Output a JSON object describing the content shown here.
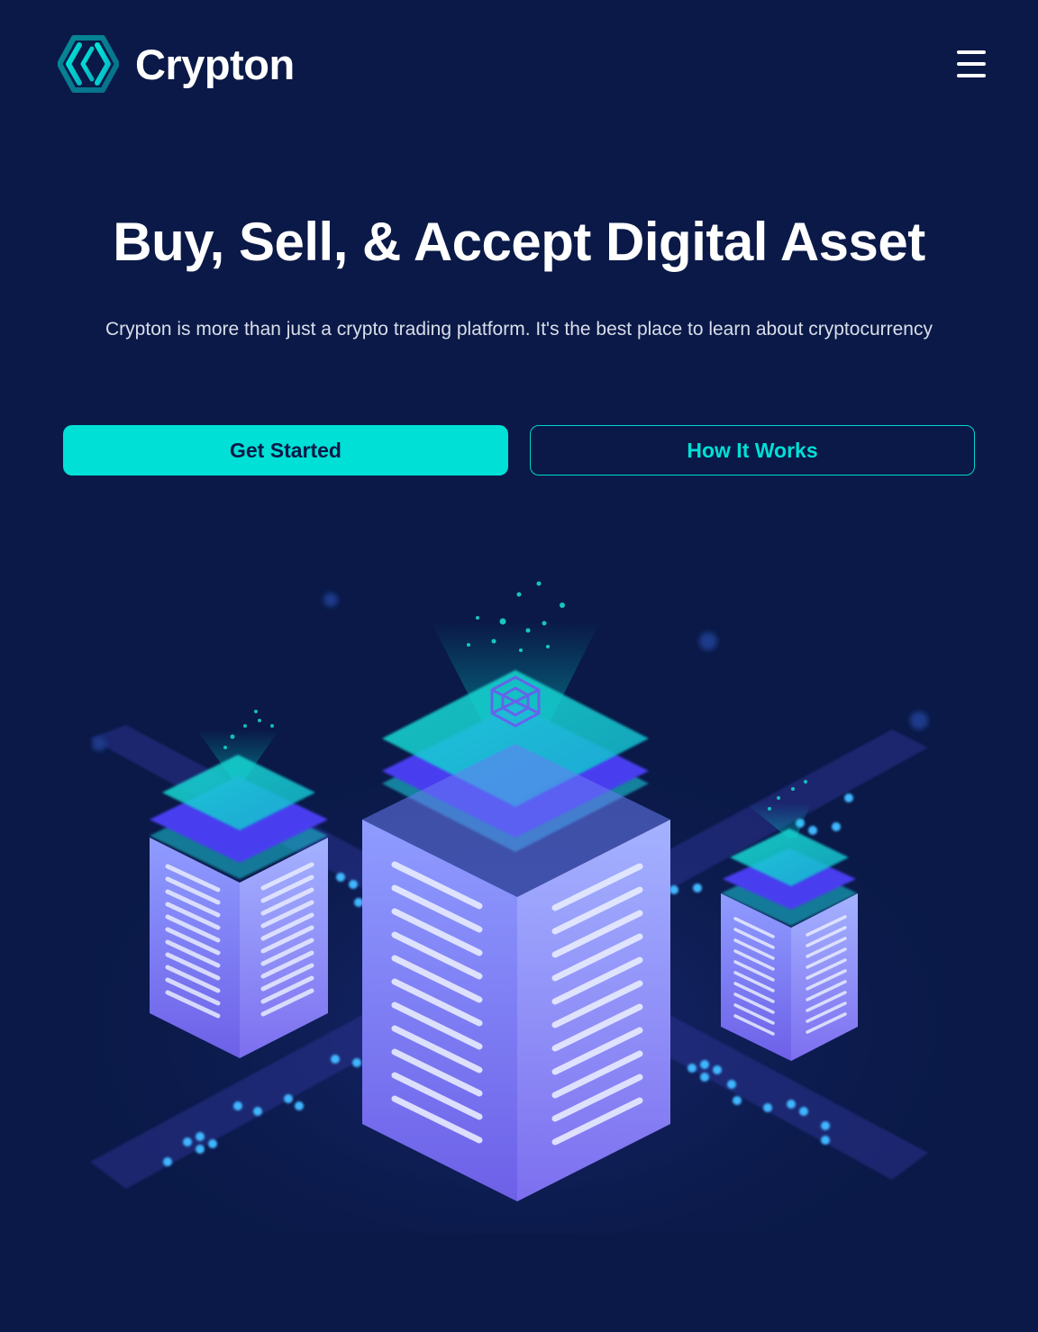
{
  "header": {
    "brand_name": "Crypton",
    "logo_icon": "crypton-hexagon-logo-icon",
    "menu_icon": "hamburger-menu-icon"
  },
  "hero": {
    "title": "Buy, Sell, & Accept Digital Asset",
    "subtitle": "Crypton is more than just a crypto trading platform. It's the best place to learn about cryptocurrency",
    "primary_button": "Get Started",
    "secondary_button": "How It Works"
  },
  "illustration": {
    "icon": "isometric-server-towers-illustration"
  },
  "colors": {
    "background": "#0a1947",
    "accent": "#00e0d6",
    "text": "#ffffff"
  }
}
